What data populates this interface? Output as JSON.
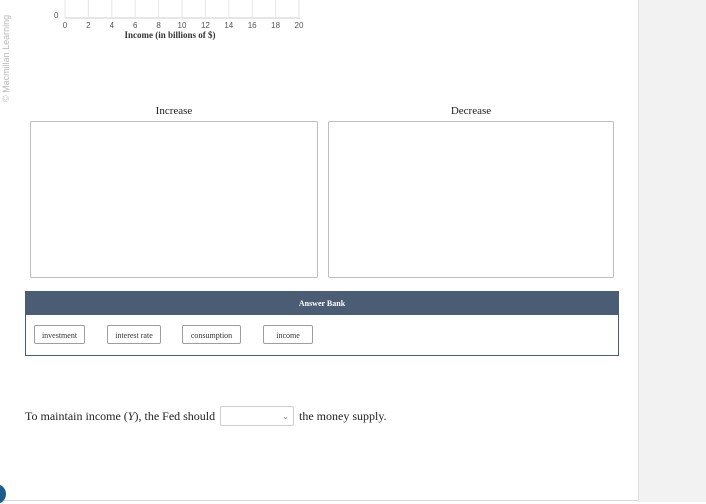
{
  "watermark": "© Macmillan Learning",
  "chart": {
    "y_tick_zero": "0",
    "x_ticks": [
      "0",
      "2",
      "4",
      "6",
      "8",
      "10",
      "12",
      "14",
      "16",
      "18",
      "20"
    ],
    "x_label": "Income (in billions of $)"
  },
  "zones": {
    "increase_label": "Increase",
    "decrease_label": "Decrease"
  },
  "answer_bank": {
    "title": "Answer Bank",
    "chips": [
      "investment",
      "interest rate",
      "consumption",
      "income"
    ]
  },
  "question": {
    "prefix": "To maintain income (",
    "var": "Y",
    "middle": "), the Fed should",
    "selected_value": "",
    "suffix": "the money supply."
  },
  "colors": {
    "bank_header": "#4a5d74",
    "side_panel": "#f2f2f2"
  }
}
